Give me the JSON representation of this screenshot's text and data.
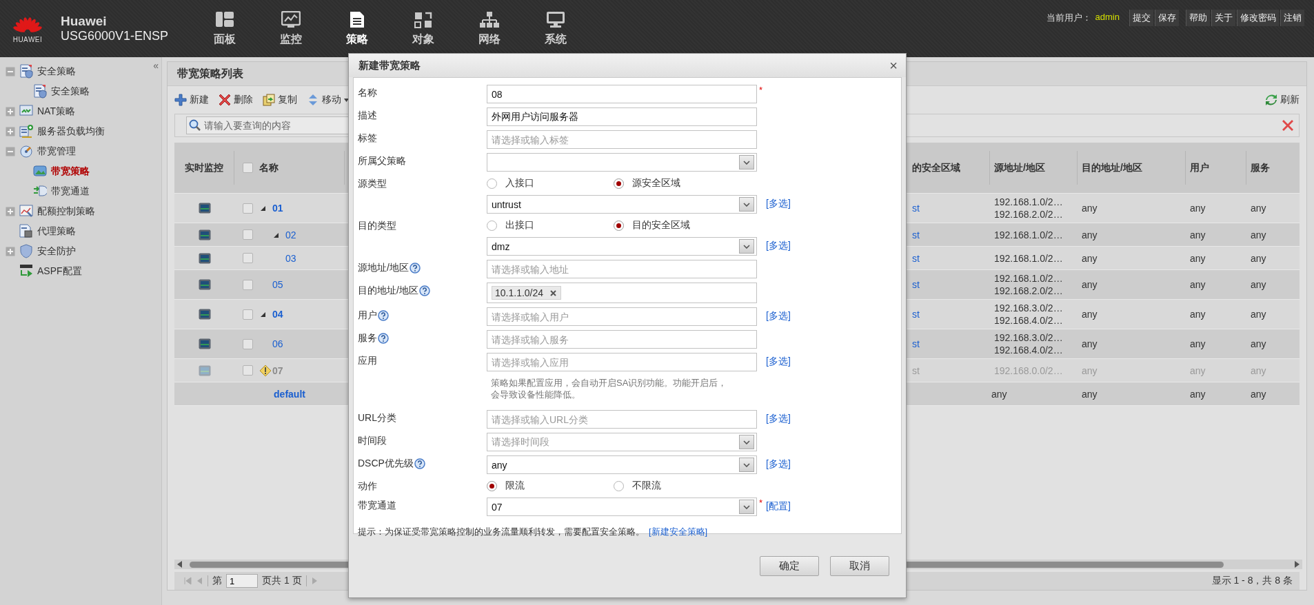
{
  "header": {
    "logo_text": "HUAWEI",
    "brand": "Huawei",
    "model": "USG6000V1-ENSP",
    "nav": [
      {
        "label": "面板",
        "selected": false
      },
      {
        "label": "监控",
        "selected": false
      },
      {
        "label": "策略",
        "selected": true
      },
      {
        "label": "对象",
        "selected": false
      },
      {
        "label": "网络",
        "selected": false
      },
      {
        "label": "系统",
        "selected": false
      }
    ],
    "user_label": "当前用户：",
    "user": "admin",
    "action_groups": [
      {
        "items": [
          "提交",
          "保存"
        ]
      },
      {
        "items": [
          "帮助",
          "关于",
          "修改密码",
          "注销"
        ]
      }
    ]
  },
  "sidebar": {
    "collapse": "«",
    "items": [
      {
        "label": "安全策略",
        "expanded": true,
        "children": [
          {
            "label": "安全策略",
            "selected": false
          }
        ]
      },
      {
        "label": "NAT策略",
        "expanded": false
      },
      {
        "label": "服务器负载均衡",
        "expanded": false
      },
      {
        "label": "带宽管理",
        "expanded": true,
        "children": [
          {
            "label": "带宽策略",
            "selected": true
          },
          {
            "label": "带宽通道",
            "selected": false
          }
        ]
      },
      {
        "label": "配额控制策略",
        "expanded": false
      },
      {
        "label": "代理策略"
      },
      {
        "label": "安全防护",
        "expanded": false
      },
      {
        "label": "ASPF配置"
      }
    ]
  },
  "panel": {
    "title": "带宽策略列表",
    "toolbar": [
      {
        "label": "新建"
      },
      {
        "label": "删除"
      },
      {
        "label": "复制"
      },
      {
        "label": "移动"
      }
    ],
    "refresh": "刷新",
    "search": {
      "placeholder": "请输入要查询的内容"
    },
    "table": {
      "select_all_checked": false,
      "columns": [
        "实时监控",
        "名称",
        "的安全区域",
        "源地址/地区",
        "目的地址/地区",
        "用户",
        "服务"
      ],
      "rows": [
        {
          "name": "01",
          "checked": false,
          "expanded": true,
          "disabled": false,
          "zone": "st",
          "source": [
            "192.168.1.0/2…",
            "192.168.2.0/2…"
          ],
          "destination": "any",
          "user": "any",
          "service": "any",
          "children": [
            {
              "name": "02",
              "checked": false,
              "expanded": true,
              "disabled": false,
              "zone": "st",
              "source": [
                "192.168.1.0/2…"
              ],
              "destination": "any",
              "user": "any",
              "service": "any",
              "children": [
                {
                  "name": "03",
                  "checked": false,
                  "disabled": false,
                  "zone": "st",
                  "source": [
                    "192.168.1.0/2…"
                  ],
                  "destination": "any",
                  "user": "any",
                  "service": "any"
                }
              ]
            },
            {
              "name": "05",
              "checked": false,
              "disabled": false,
              "zone": "st",
              "source": [
                "192.168.1.0/2…",
                "192.168.2.0/2…"
              ],
              "destination": "any",
              "user": "any",
              "service": "any"
            }
          ]
        },
        {
          "name": "04",
          "checked": false,
          "expanded": true,
          "disabled": false,
          "zone": "st",
          "source": [
            "192.168.3.0/2…",
            "192.168.4.0/2…"
          ],
          "destination": "any",
          "user": "any",
          "service": "any",
          "children": [
            {
              "name": "06",
              "checked": false,
              "disabled": false,
              "zone": "st",
              "source": [
                "192.168.3.0/2…",
                "192.168.4.0/2…"
              ],
              "destination": "any",
              "user": "any",
              "service": "any"
            },
            {
              "name": "07",
              "checked": false,
              "disabled": true,
              "zone": "st",
              "source": [
                "192.168.0.0/2…"
              ],
              "destination": "any",
              "user": "any",
              "service": "any"
            }
          ]
        }
      ],
      "default_row": {
        "name": "default",
        "source": "any",
        "destination": "any",
        "user": "any",
        "service": "any"
      }
    },
    "pager": {
      "page_label": "第",
      "page": "1",
      "total": "页共 1 页",
      "summary": "显示 1 - 8，共 8 条"
    }
  },
  "modal": {
    "title": "新建带宽策略",
    "close": "×",
    "fields": [
      {
        "kind": "input",
        "label": "名称",
        "value": "08",
        "required_mark": "*"
      },
      {
        "kind": "input",
        "label": "描述",
        "value": "外网用户访问服务器"
      },
      {
        "kind": "input",
        "label": "标签",
        "placeholder": "请选择或输入标签"
      },
      {
        "kind": "select",
        "label": "所属父策略"
      },
      {
        "kind": "radio",
        "label": "源类型",
        "options": [
          {
            "label": "入接口",
            "selected": false
          },
          {
            "label": "源安全区域",
            "selected": true
          }
        ]
      },
      {
        "kind": "select",
        "value": "untrust",
        "link": "[多选]"
      },
      {
        "kind": "radio",
        "label": "目的类型",
        "options": [
          {
            "label": "出接口",
            "selected": false
          },
          {
            "label": "目的安全区域",
            "selected": true
          }
        ]
      },
      {
        "kind": "select",
        "value": "dmz",
        "link": "[多选]"
      },
      {
        "kind": "input",
        "label": "源地址/地区",
        "help": true,
        "placeholder": "请选择或输入地址"
      },
      {
        "kind": "tags",
        "label": "目的地址/地区",
        "help": true,
        "tags": [
          "10.1.1.0/24"
        ]
      },
      {
        "kind": "input",
        "label": "用户",
        "help": true,
        "placeholder": "请选择或输入用户",
        "link": "[多选]"
      },
      {
        "kind": "input",
        "label": "服务",
        "help": true,
        "placeholder": "请选择或输入服务"
      },
      {
        "kind": "input",
        "label": "应用",
        "placeholder": "请选择或输入应用",
        "link": "[多选]"
      },
      {
        "kind": "note",
        "text": "策略如果配置应用，会自动开启SA识别功能。功能开启后，会导致设备性能降低。"
      },
      {
        "kind": "input",
        "label": "URL分类",
        "placeholder": "请选择或输入URL分类",
        "link": "[多选]"
      },
      {
        "kind": "select",
        "label": "时间段",
        "placeholder": "请选择时间段"
      },
      {
        "kind": "select",
        "label": "DSCP优先级",
        "help": true,
        "value": "any",
        "link": "[多选]"
      },
      {
        "kind": "radio",
        "label": "动作",
        "options": [
          {
            "label": "限流",
            "selected": true
          },
          {
            "label": "不限流",
            "selected": false
          }
        ]
      },
      {
        "kind": "select",
        "label": "带宽通道",
        "value": "07",
        "required_mark": "*",
        "link": "[配置]"
      }
    ],
    "hint": "提示：为保证受带宽策略控制的业务流量顺利转发，需要配置安全策略。",
    "hint_link": "[新建安全策略]",
    "buttons": [
      "确定",
      "取消"
    ]
  }
}
